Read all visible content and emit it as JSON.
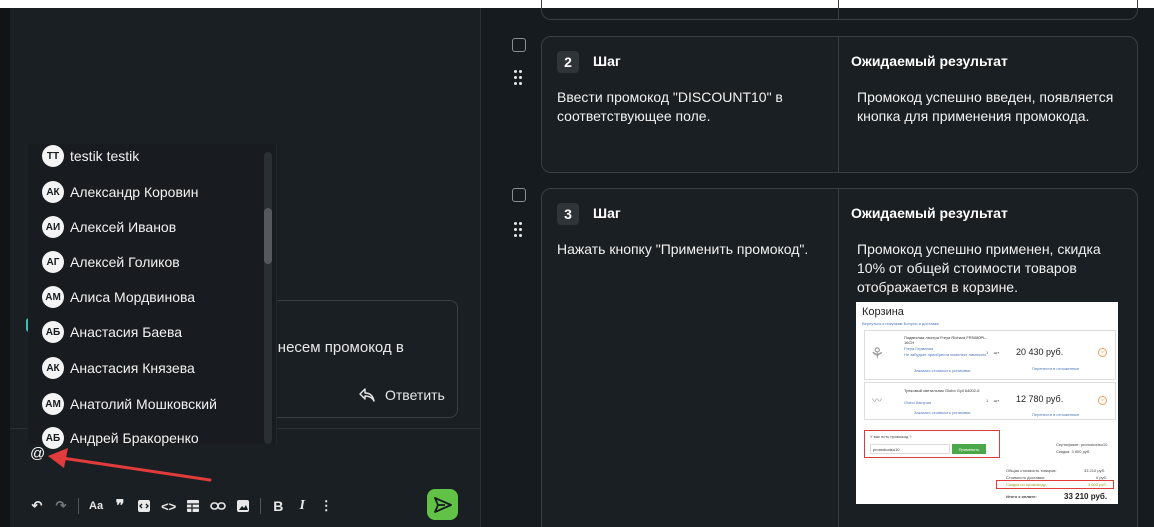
{
  "comment": {
    "text_fragment": "ынесем промокод в",
    "reply_label": "Ответить"
  },
  "editor": {
    "input_value": "@"
  },
  "mentions": [
    {
      "initials": "TT",
      "name": "testik testik"
    },
    {
      "initials": "АК",
      "name": "Александр Коровин"
    },
    {
      "initials": "АИ",
      "name": "Алексей Иванов"
    },
    {
      "initials": "АГ",
      "name": "Алексей Голиков"
    },
    {
      "initials": "АМ",
      "name": "Алиса Мордвинова"
    },
    {
      "initials": "АБ",
      "name": "Анастасия Баева"
    },
    {
      "initials": "АК",
      "name": "Анастасия Князева"
    },
    {
      "initials": "АМ",
      "name": "Анатолий Мошковский"
    },
    {
      "initials": "АБ",
      "name": "Андрей Бракоренко"
    }
  ],
  "toolbar": {
    "font_size": "Aa",
    "bold": "B",
    "italic": "I"
  },
  "steps": [
    {
      "number": "2",
      "label": "Шаг",
      "expected_header": "Ожидаемый результат",
      "action": "Ввести промокод \"DISCOUNT10\" в соответствующее поле.",
      "expected": "Промокод успешно введен, появляется кнопка для применения промокода."
    },
    {
      "number": "3",
      "label": "Шаг",
      "expected_header": "Ожидаемый результат",
      "action": "Нажать кнопку \"Применить промокод\".",
      "expected": "Промокод успешно применен, скидка 10% от общей стоимости товаров отображается в корзине."
    }
  ],
  "cart": {
    "title": "Корзина",
    "subtitle": "Вернуться к покупкам    Бонусы и доставка",
    "items": [
      {
        "name": "Подвесная люстра Freya Richard FR5080PL-16CH",
        "brand": "Freya Германия",
        "note": "Не забудьте приобрести комплект лампочек",
        "qty": "1",
        "unit": "шт",
        "price": "20 430 руб.",
        "install": "Заказать стоимость установки",
        "defer": "Перенести в отложенные"
      },
      {
        "name": "Трековый светильник Globo Gyll 64002-6",
        "brand": "Globo Австрия",
        "qty": "1",
        "unit": "шт",
        "price": "12 780 руб.",
        "install": "Заказать стоимость установки",
        "defer": "Перенести в отложенные"
      }
    ],
    "promo_question": "У вас есть промокод ?",
    "promo_value": "promokodsu10",
    "apply_button": "Применить",
    "certificate": "Сертификат: promokodsu10",
    "certificate_discount": "Скидка: 3 600 руб.",
    "summary": [
      {
        "label": "Общая стоимость товаров:",
        "value": "33 210 руб."
      },
      {
        "label": "Стоимость доставки:",
        "value": "0 руб."
      },
      {
        "label": "Скидка по промокоду:",
        "value": "3 600 руб."
      }
    ],
    "total_label": "Итого к оплате:",
    "total_value": "33 210 руб."
  }
}
